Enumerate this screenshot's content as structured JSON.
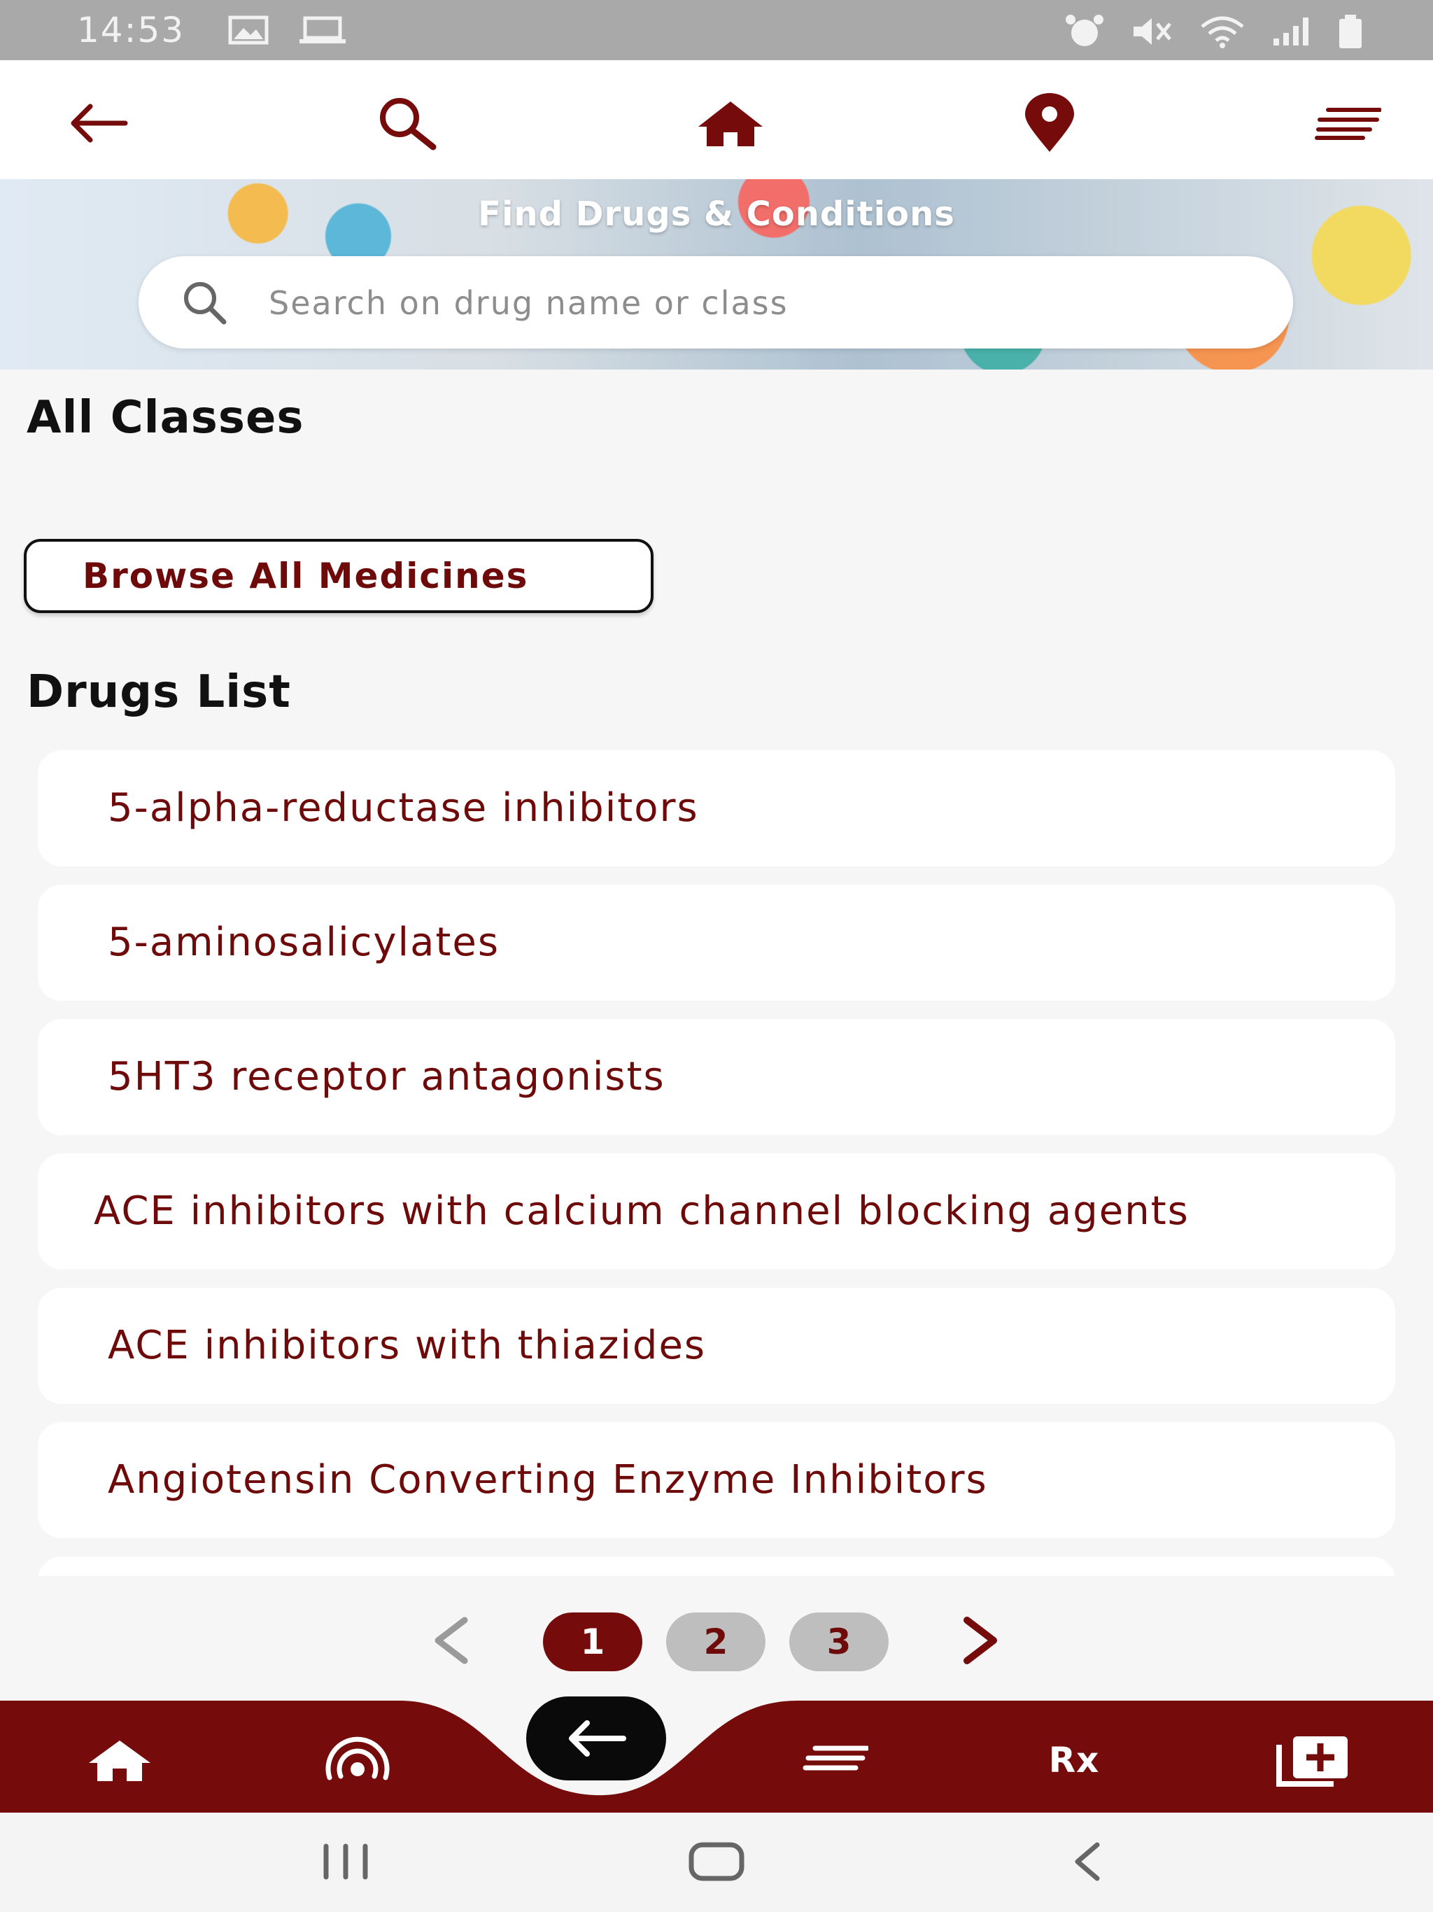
{
  "status_bar": {
    "time": "14:53"
  },
  "top_nav": {
    "icons": [
      "back-arrow-icon",
      "search-icon",
      "home-icon",
      "location-pin-icon",
      "menu-icon"
    ]
  },
  "hero": {
    "title": "Find Drugs & Conditions",
    "search_placeholder": "Search on drug name or class"
  },
  "all_classes": {
    "heading": "All Classes",
    "browse_button": "Browse All Medicines"
  },
  "drugs_list": {
    "heading": "Drugs List",
    "items": [
      "5-alpha-reductase inhibitors",
      "5-aminosalicylates",
      "5HT3 receptor antagonists",
      "ACE inhibitors with calcium channel blocking agents",
      "ACE inhibitors with thiazides",
      "Angiotensin Converting Enzyme Inhibitors"
    ]
  },
  "pagination": {
    "pages": [
      "1",
      "2",
      "3"
    ],
    "current": "1"
  },
  "bottom_nav": {
    "rx_label": "Rx",
    "icons": [
      "home-icon",
      "podcast-icon",
      "back-arrow-icon",
      "menu-icon",
      "add-box-icon"
    ]
  },
  "colors": {
    "brand": "#750b0b",
    "text_brand": "#6e0a0a",
    "background": "#f6f6f6",
    "status_bar": "#a9a9a9"
  }
}
